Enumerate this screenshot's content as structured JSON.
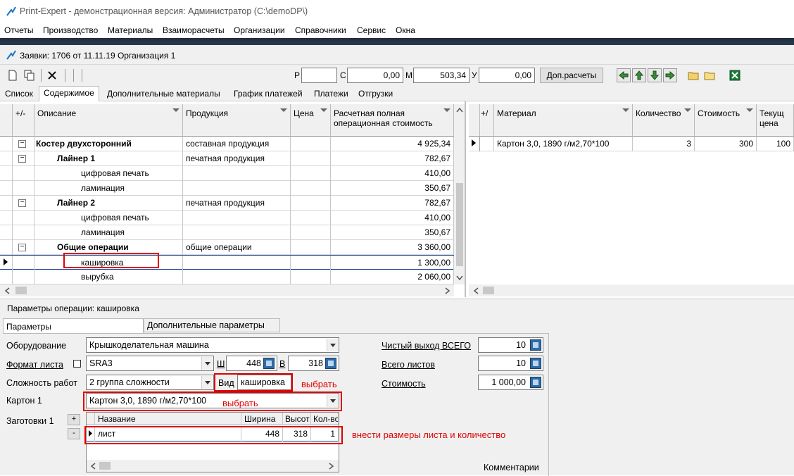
{
  "window": {
    "title": "Print-Expert - демонстрационная версия: Администратор (C:\\demoDP\\)"
  },
  "menu": [
    "Отчеты",
    "Производство",
    "Материалы",
    "Взаиморасчеты",
    "Организации",
    "Справочники",
    "Сервис",
    "Окна"
  ],
  "document": {
    "title": "Заявки: 1706 от 11.11.19  Организация 1"
  },
  "toolbar": {
    "p_label": "Р",
    "p_value": "",
    "c_label": "С",
    "c_value": "0,00",
    "m_label": "М",
    "m_value": "503,34",
    "u_label": "У",
    "u_value": "0,00",
    "extra_calc_label": "Доп.расчеты"
  },
  "tabs": [
    "Список",
    "Содержимое",
    "Дополнительные материалы",
    "График платежей",
    "Платежи",
    "Отгрузки"
  ],
  "active_tab": "Содержимое",
  "left_grid": {
    "headers": {
      "pm": "+/-",
      "desc": "Описание",
      "product": "Продукция",
      "price": "Цена",
      "cost": "Расчетная полная операционная стоимость"
    },
    "rows": [
      {
        "desc": "Костер двухсторонний",
        "product": "составная продукция",
        "price": "",
        "cost": "4 925,34"
      },
      {
        "desc": "Лайнер 1",
        "product": "печатная продукция",
        "price": "",
        "cost": "782,67"
      },
      {
        "desc": "цифровая печать",
        "product": "",
        "price": "",
        "cost": "410,00"
      },
      {
        "desc": "ламинация",
        "product": "",
        "price": "",
        "cost": "350,67"
      },
      {
        "desc": "Лайнер 2",
        "product": "печатная продукция",
        "price": "",
        "cost": "782,67"
      },
      {
        "desc": "цифровая печать",
        "product": "",
        "price": "",
        "cost": "410,00"
      },
      {
        "desc": "ламинация",
        "product": "",
        "price": "",
        "cost": "350,67"
      },
      {
        "desc": "Общие операции",
        "product": "общие операции",
        "price": "",
        "cost": "3 360,00"
      },
      {
        "desc": "кашировка",
        "product": "",
        "price": "",
        "cost": "1 300,00"
      },
      {
        "desc": "вырубка",
        "product": "",
        "price": "",
        "cost": "2 060,00"
      }
    ]
  },
  "right_grid": {
    "headers": {
      "pm": "+/",
      "material": "Материал",
      "qty": "Количество",
      "cost": "Стоимость",
      "curprice": "Текущ цена"
    },
    "rows": [
      {
        "material": "Картон 3,0, 1890 г/м2,70*100",
        "qty": "3",
        "cost": "300",
        "curprice": "100"
      }
    ]
  },
  "params": {
    "title": "Параметры операции: кашировка",
    "tab_params": "Параметры",
    "tab_extra": "Дополнительные параметры",
    "equipment_label": "Оборудование",
    "equipment_value": "Крышкоделательная машина",
    "sheet_format_label": "Формат листа",
    "sheet_format_value": "SRA3",
    "w_label": "Ш",
    "w_value": "448",
    "h_label": "В",
    "h_value": "318",
    "complexity_label": "Сложность работ",
    "complexity_value": "2 группа сложности",
    "kind_label": "Вид",
    "kind_value": "кашировка",
    "cardboard_label": "Картон 1",
    "cardboard_value": "Картон 3,0, 1890 г/м2,70*100",
    "blanks_label": "Заготовки 1",
    "blanks_headers": {
      "name": "Название",
      "width": "Ширина",
      "height": "Высот",
      "qty": "Кол-во"
    },
    "blanks_rows": [
      {
        "name": "лист",
        "width": "448",
        "height": "318",
        "qty": "1"
      }
    ],
    "net_output_label": "Чистый выход ВСЕГО",
    "net_output_value": "10",
    "total_sheets_label": "Всего листов",
    "total_sheets_value": "10",
    "cost_label": "Стоимость",
    "cost_value": "1 000,00",
    "comments_label": "Комментарии",
    "plus": "+",
    "minus": "-"
  },
  "annotations": {
    "choose1": "выбрать",
    "choose2": "выбрать",
    "enter_sizes": "внести размеры листа и количество"
  }
}
